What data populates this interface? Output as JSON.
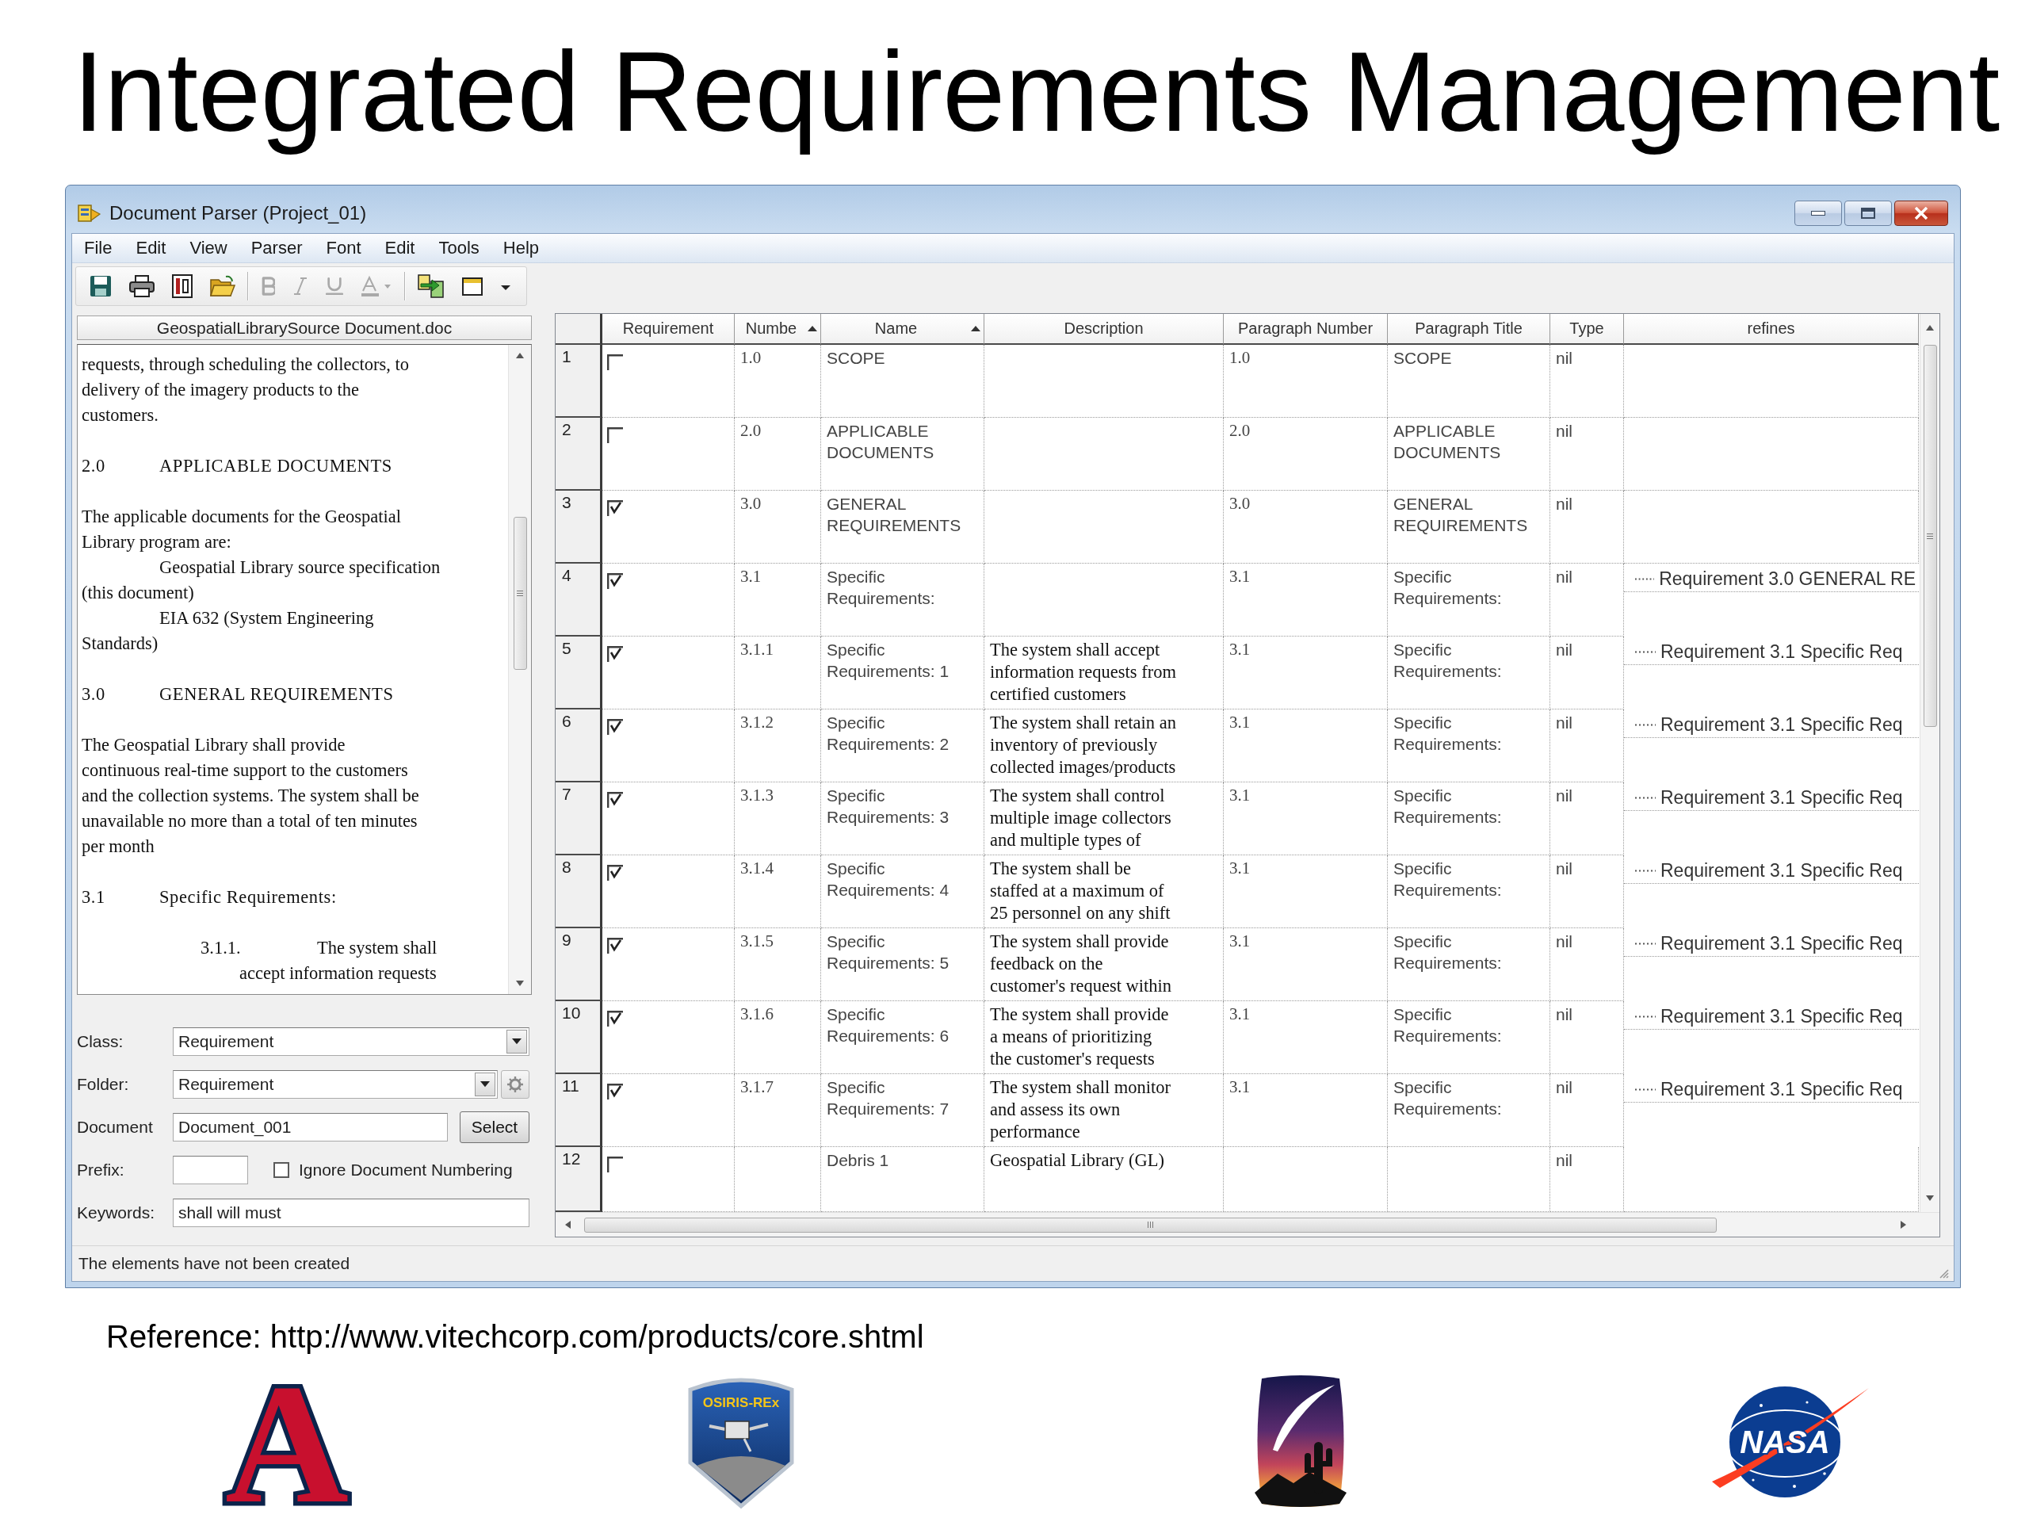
{
  "slide_title": "Integrated Requirements Management",
  "window": {
    "title": "Document Parser (Project_01)"
  },
  "menu": [
    "File",
    "Edit",
    "View",
    "Parser",
    "Font",
    "Edit",
    "Tools",
    "Help"
  ],
  "toolbar": [
    {
      "kind": "save",
      "disabled": false
    },
    {
      "kind": "print",
      "disabled": false
    },
    {
      "kind": "book",
      "disabled": false
    },
    {
      "kind": "open",
      "disabled": false
    },
    {
      "kind": "separator"
    },
    {
      "kind": "bold",
      "disabled": true
    },
    {
      "kind": "italic",
      "disabled": true
    },
    {
      "kind": "underline",
      "disabled": true
    },
    {
      "kind": "color",
      "disabled": true
    },
    {
      "kind": "separator"
    },
    {
      "kind": "import",
      "disabled": false
    },
    {
      "kind": "window",
      "disabled": false
    },
    {
      "kind": "overflow",
      "disabled": false
    }
  ],
  "document_panel": {
    "tab": "GeospatialLibrarySource Document.doc",
    "blocks": [
      {
        "kind": "body",
        "lines": [
          "requests, through scheduling the collectors, to",
          "delivery of the imagery products to the",
          "customers."
        ]
      },
      {
        "kind": "heading",
        "number": "2.0",
        "title": "APPLICABLE DOCUMENTS"
      },
      {
        "kind": "body",
        "lines": [
          "The applicable documents for the Geospatial",
          "Library program are:"
        ],
        "items": [
          {
            "lines": [
              "Geospatial Library source specification",
              "(this document)"
            ]
          },
          {
            "lines": [
              "EIA 632 (System Engineering",
              "Standards)"
            ]
          }
        ]
      },
      {
        "kind": "heading",
        "number": "3.0",
        "title": "GENERAL REQUIREMENTS"
      },
      {
        "kind": "body",
        "lines": [
          "The Geospatial Library shall provide",
          "continuous real-time support to the customers",
          "and the collection systems. The system shall be",
          "unavailable no more than a total of ten minutes",
          "per month"
        ]
      },
      {
        "kind": "heading",
        "number": "3.1",
        "title": "Specific Requirements:"
      },
      {
        "kind": "subitem",
        "number": "3.1.1.",
        "lines": [
          "The system shall",
          "accept information requests"
        ]
      }
    ]
  },
  "form": {
    "class": {
      "label": "Class:",
      "value": "Requirement"
    },
    "folder": {
      "label": "Folder:",
      "value": "Requirement"
    },
    "document": {
      "label": "Document",
      "value": "Document_001",
      "button": "Select"
    },
    "prefix": {
      "label": "Prefix:",
      "option": {
        "label": "Ignore Document Numbering",
        "checked": false
      }
    },
    "keywords": {
      "label": "Keywords:",
      "value": "shall will must"
    }
  },
  "table": {
    "columns": [
      {
        "label": "Requirement",
        "sorted": false
      },
      {
        "label": "Numbe",
        "sorted": true
      },
      {
        "label": "Name",
        "sorted": true
      },
      {
        "label": "Description",
        "sorted": false
      },
      {
        "label": "Paragraph Number",
        "sorted": false
      },
      {
        "label": "Paragraph Title",
        "sorted": false
      },
      {
        "label": "Type",
        "sorted": false
      },
      {
        "label": "refines",
        "sorted": false
      }
    ],
    "rows": [
      {
        "row": "1",
        "checked": false,
        "number": "1.0",
        "name": "SCOPE",
        "paragraph_number": "1.0",
        "paragraph_title": "SCOPE",
        "type": "nil"
      },
      {
        "row": "2",
        "checked": false,
        "number": "2.0",
        "name": "APPLICABLE DOCUMENTS",
        "paragraph_number": "2.0",
        "paragraph_title": "APPLICABLE DOCUMENTS",
        "type": "nil"
      },
      {
        "row": "3",
        "checked": true,
        "number": "3.0",
        "name": "GENERAL REQUIREMENTS",
        "paragraph_number": "3.0",
        "paragraph_title": "GENERAL REQUIREMENTS",
        "type": "nil"
      },
      {
        "row": "4",
        "checked": true,
        "number": "3.1",
        "name": "Specific Requirements:",
        "paragraph_number": "3.1",
        "paragraph_title": "Specific Requirements:",
        "type": "nil",
        "refines": "Requirement 3.0 GENERAL RE"
      },
      {
        "row": "5",
        "checked": true,
        "number": "3.1.1",
        "name": "Specific Requirements: 1",
        "description": [
          "The system shall accept",
          "information requests from",
          "certified customers"
        ],
        "paragraph_number": "3.1",
        "paragraph_title": "Specific Requirements:",
        "type": "nil",
        "refines": "Requirement 3.1 Specific Req"
      },
      {
        "row": "6",
        "checked": true,
        "number": "3.1.2",
        "name": "Specific Requirements: 2",
        "description": [
          "The system shall retain an",
          "inventory of previously",
          "collected images/products"
        ],
        "paragraph_number": "3.1",
        "paragraph_title": "Specific Requirements:",
        "type": "nil",
        "refines": "Requirement 3.1 Specific Req"
      },
      {
        "row": "7",
        "checked": true,
        "number": "3.1.3",
        "name": "Specific Requirements: 3",
        "description": [
          "The system shall control",
          "multiple image collectors",
          "and multiple types of"
        ],
        "paragraph_number": "3.1",
        "paragraph_title": "Specific Requirements:",
        "type": "nil",
        "refines": "Requirement 3.1 Specific Req"
      },
      {
        "row": "8",
        "checked": true,
        "number": "3.1.4",
        "name": "Specific Requirements: 4",
        "description": [
          "The system shall be",
          "staffed at a maximum of",
          "25 personnel on any shift"
        ],
        "paragraph_number": "3.1",
        "paragraph_title": "Specific Requirements:",
        "type": "nil",
        "refines": "Requirement 3.1 Specific Req"
      },
      {
        "row": "9",
        "checked": true,
        "number": "3.1.5",
        "name": "Specific Requirements: 5",
        "description": [
          "The system shall provide",
          "feedback on the",
          "customer's request within"
        ],
        "paragraph_number": "3.1",
        "paragraph_title": "Specific Requirements:",
        "type": "nil",
        "refines": "Requirement 3.1 Specific Req"
      },
      {
        "row": "10",
        "checked": true,
        "number": "3.1.6",
        "name": "Specific Requirements: 6",
        "description": [
          "The system shall provide",
          "a means of prioritizing",
          "the customer's requests"
        ],
        "paragraph_number": "3.1",
        "paragraph_title": "Specific Requirements:",
        "type": "nil",
        "refines": "Requirement 3.1 Specific Req"
      },
      {
        "row": "11",
        "checked": true,
        "number": "3.1.7",
        "name": "Specific Requirements: 7",
        "description": [
          "The system shall monitor",
          "and assess its own",
          "performance"
        ],
        "paragraph_number": "3.1",
        "paragraph_title": "Specific Requirements:",
        "type": "nil",
        "refines": "Requirement 3.1 Specific Req"
      },
      {
        "row": "12",
        "checked": false,
        "name": "Debris 1",
        "description": [
          "Geospatial Library (GL)"
        ],
        "type": "nil"
      }
    ]
  },
  "status_bar": "The elements have not been created",
  "reference": "Reference: http://www.vitechcorp.com/products/core.shtml",
  "logos": [
    {
      "kind": "block_letter",
      "text": "A"
    },
    {
      "kind": "patch",
      "text": "OSIRIS-REx"
    },
    {
      "kind": "sunset"
    },
    {
      "kind": "emblem",
      "text": "NASA"
    }
  ]
}
